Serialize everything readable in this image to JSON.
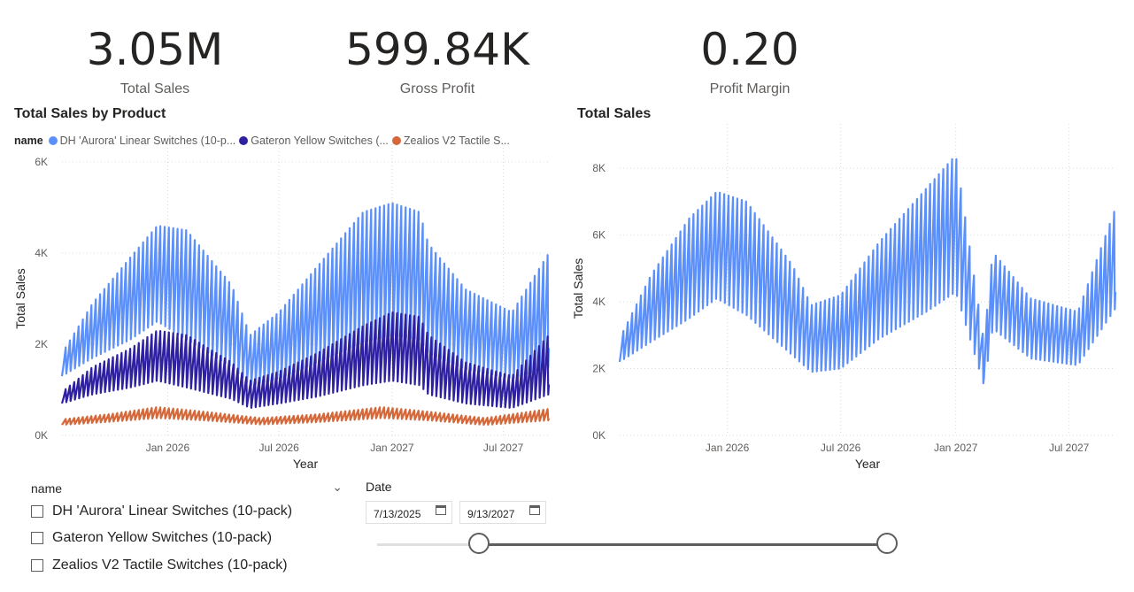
{
  "kpis": [
    {
      "value": "3.05M",
      "label": "Total Sales"
    },
    {
      "value": "599.84K",
      "label": "Gross Profit"
    },
    {
      "value": "0.20",
      "label": "Profit Margin"
    }
  ],
  "colors": {
    "aurora": "#5b8ff9",
    "gateron": "#2e20a0",
    "zealios": "#d4683a",
    "total": "#5b8ff9",
    "grid": "#d9d9d9",
    "axis_text": "#605e5c"
  },
  "legend": {
    "title": "name",
    "items": [
      "DH 'Aurora' Linear Switches (10-p...",
      "Gateron Yellow Switches (...",
      "Zealios V2 Tactile S..."
    ]
  },
  "chart_data": [
    {
      "type": "line",
      "title": "Total Sales by Product",
      "xlabel": "Year",
      "ylabel": "Total Sales",
      "x_range": [
        "2025-07-13",
        "2027-09-13"
      ],
      "ylim": [
        0,
        6000
      ],
      "y_ticks": [
        "0K",
        "2K",
        "4K",
        "6K"
      ],
      "x_ticks": [
        {
          "date": "2026-01-01",
          "label": "Jan 2026"
        },
        {
          "date": "2026-07-01",
          "label": "Jul 2026"
        },
        {
          "date": "2027-01-01",
          "label": "Jan 2027"
        },
        {
          "date": "2027-07-01",
          "label": "Jul 2027"
        }
      ],
      "grid": true,
      "legend_position": "top-left",
      "series": [
        {
          "name": "DH 'Aurora' Linear Switches (10-pack)",
          "x": [
            "2025-07-13",
            "2025-09-01",
            "2025-11-01",
            "2025-12-15",
            "2026-02-01",
            "2026-04-15",
            "2026-05-15",
            "2026-07-01",
            "2026-09-01",
            "2026-11-15",
            "2027-01-01",
            "2027-02-15",
            "2027-03-01",
            "2027-05-01",
            "2027-07-15",
            "2027-09-13"
          ],
          "low": [
            1300,
            1700,
            2100,
            2500,
            2100,
            1500,
            1100,
            1250,
            1600,
            2050,
            2200,
            2100,
            1800,
            1450,
            1250,
            1500
          ],
          "high": [
            1800,
            2900,
            3900,
            4600,
            4500,
            3300,
            2200,
            2700,
            3700,
            4900,
            5100,
            4900,
            4200,
            3200,
            2700,
            4000
          ]
        },
        {
          "name": "Gateron Yellow Switches (10-pack)",
          "x": [
            "2025-07-13",
            "2025-09-01",
            "2025-11-01",
            "2025-12-15",
            "2026-02-01",
            "2026-04-15",
            "2026-05-15",
            "2026-07-01",
            "2026-09-01",
            "2026-11-15",
            "2027-01-01",
            "2027-02-15",
            "2027-03-01",
            "2027-05-01",
            "2027-07-15",
            "2027-09-13"
          ],
          "low": [
            700,
            900,
            1050,
            1200,
            1050,
            800,
            600,
            700,
            850,
            1100,
            1200,
            1100,
            900,
            700,
            600,
            900
          ],
          "high": [
            950,
            1500,
            1900,
            2300,
            2200,
            1600,
            1200,
            1400,
            1800,
            2400,
            2700,
            2600,
            2200,
            1600,
            1300,
            2200
          ]
        },
        {
          "name": "Zealios V2 Tactile Switches (10-pack)",
          "x": [
            "2025-07-13",
            "2025-10-01",
            "2025-12-15",
            "2026-03-01",
            "2026-06-01",
            "2026-09-01",
            "2026-12-15",
            "2027-03-01",
            "2027-06-01",
            "2027-09-13"
          ],
          "low": [
            230,
            300,
            380,
            330,
            240,
            290,
            380,
            330,
            230,
            330
          ],
          "high": [
            350,
            470,
            620,
            520,
            380,
            460,
            620,
            520,
            380,
            580
          ]
        }
      ]
    },
    {
      "type": "line",
      "title": "Total Sales",
      "xlabel": "Year",
      "ylabel": "Total Sales",
      "x_range": [
        "2025-07-13",
        "2027-09-13"
      ],
      "ylim": [
        0,
        8800
      ],
      "y_ticks": [
        "0K",
        "2K",
        "4K",
        "6K",
        "8K"
      ],
      "x_ticks": [
        {
          "date": "2026-01-01",
          "label": "Jan 2026"
        },
        {
          "date": "2026-07-01",
          "label": "Jul 2026"
        },
        {
          "date": "2027-01-01",
          "label": "Jan 2027"
        },
        {
          "date": "2027-07-01",
          "label": "Jul 2027"
        }
      ],
      "grid": true,
      "series": [
        {
          "name": "Total Sales",
          "x": [
            "2025-07-13",
            "2025-09-01",
            "2025-11-01",
            "2025-12-15",
            "2026-02-01",
            "2026-04-15",
            "2026-05-15",
            "2026-07-01",
            "2026-09-01",
            "2026-11-15",
            "2027-01-01",
            "2027-02-15",
            "2027-03-01",
            "2027-05-01",
            "2027-07-15",
            "2027-09-13"
          ],
          "low": [
            2200,
            2800,
            3500,
            4100,
            3600,
            2400,
            1900,
            2000,
            2900,
            3700,
            4300,
            1500,
            3200,
            2300,
            2100,
            3800
          ],
          "high": [
            2900,
            4800,
            6500,
            7300,
            7000,
            5100,
            3900,
            4200,
            5800,
            7400,
            8400,
            2800,
            5500,
            4100,
            3700,
            6800
          ]
        }
      ]
    }
  ],
  "slicer": {
    "header": "name",
    "items": [
      "DH 'Aurora' Linear Switches (10-pack)",
      "Gateron Yellow Switches (10-pack)",
      "Zealios V2 Tactile Switches (10-pack)"
    ]
  },
  "date_slicer": {
    "label": "Date",
    "start": "7/13/2025",
    "end": "9/13/2027",
    "handle_start_fraction": 0.2,
    "handle_end_fraction": 1.0
  }
}
